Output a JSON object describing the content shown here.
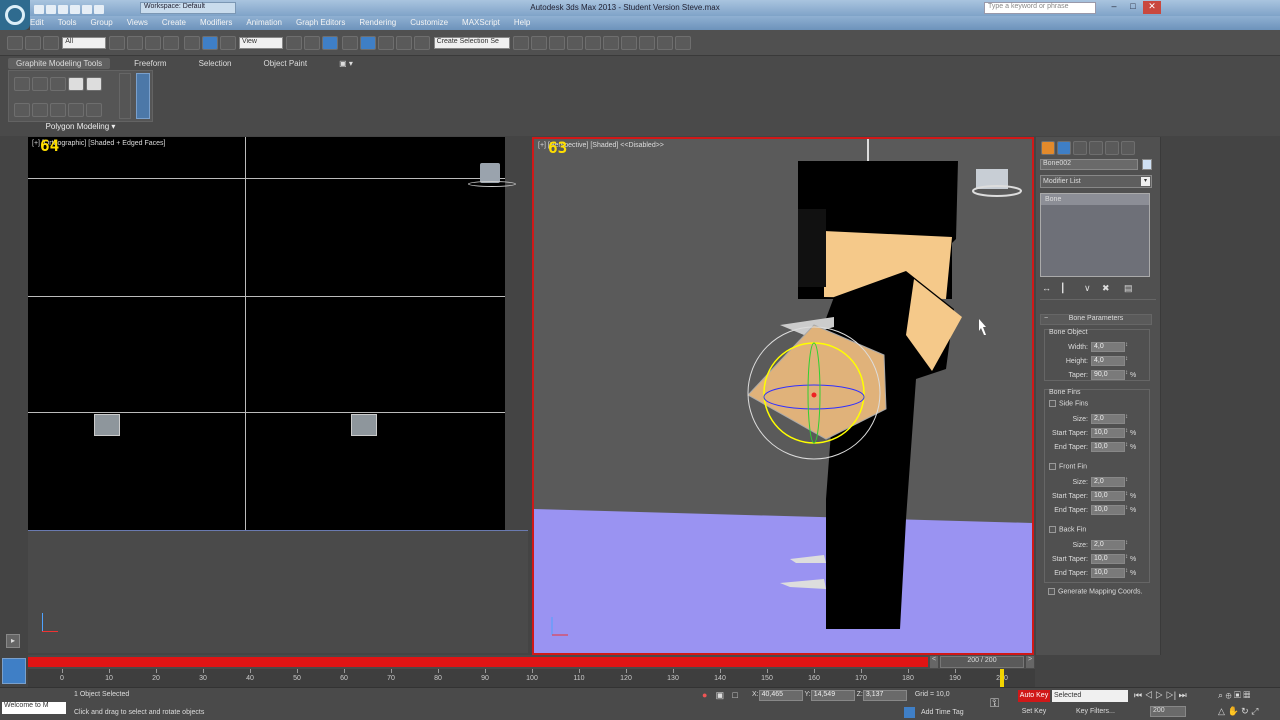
{
  "window": {
    "title": "Autodesk 3ds Max 2013 - Student Version   Steve.max",
    "workspace": "Workspace: Default",
    "search_placeholder": "Type a keyword or phrase"
  },
  "menu": [
    "Edit",
    "Tools",
    "Group",
    "Views",
    "Create",
    "Modifiers",
    "Animation",
    "Graph Editors",
    "Rendering",
    "Customize",
    "MAXScript",
    "Help"
  ],
  "toolbar": {
    "filter_value": "All",
    "refcoord_value": "View",
    "selection_set_placeholder": "Create Selection Se"
  },
  "ribbon": {
    "tabs": [
      "Graphite Modeling Tools",
      "Freeform",
      "Selection",
      "Object Paint"
    ],
    "panel_label": "Polygon Modeling"
  },
  "viewport_left": {
    "label": "[+] [Orthographic] [Shaded + Edged Faces]",
    "overlay_number": "64"
  },
  "viewport_right": {
    "label": "[+] [Perspective] [Shaded] <<Disabled>>",
    "overlay_number": "63"
  },
  "command_panel": {
    "object_name": "Bone002",
    "modifier_list": "Modifier List",
    "stack_items": [
      "Bone"
    ],
    "rollout_title": "Bone Parameters",
    "bone_object": {
      "header": "Bone Object",
      "rows": [
        {
          "label": "Width:",
          "value": "4,0",
          "unit": ""
        },
        {
          "label": "Height:",
          "value": "4,0",
          "unit": ""
        },
        {
          "label": "Taper:",
          "value": "90,0",
          "unit": "%"
        }
      ]
    },
    "bone_fins_header": "Bone Fins",
    "fins": [
      {
        "name": "Side Fins",
        "rows": [
          {
            "label": "Size:",
            "value": "2,0",
            "unit": ""
          },
          {
            "label": "Start Taper:",
            "value": "10,0",
            "unit": "%"
          },
          {
            "label": "End Taper:",
            "value": "10,0",
            "unit": "%"
          }
        ]
      },
      {
        "name": "Front Fin",
        "rows": [
          {
            "label": "Size:",
            "value": "2,0",
            "unit": ""
          },
          {
            "label": "Start Taper:",
            "value": "10,0",
            "unit": "%"
          },
          {
            "label": "End Taper:",
            "value": "10,0",
            "unit": "%"
          }
        ]
      },
      {
        "name": "Back Fin",
        "rows": [
          {
            "label": "Size:",
            "value": "2,0",
            "unit": ""
          },
          {
            "label": "Start Taper:",
            "value": "10,0",
            "unit": "%"
          },
          {
            "label": "End Taper:",
            "value": "10,0",
            "unit": "%"
          }
        ]
      }
    ],
    "generate_mapping": "Generate Mapping Coords."
  },
  "timeline": {
    "frame_display": "200 / 200",
    "current_frame": 200,
    "max_frame": 200,
    "ticks": [
      "0",
      "10",
      "20",
      "30",
      "40",
      "50",
      "60",
      "70",
      "80",
      "90",
      "100",
      "110",
      "120",
      "130",
      "140",
      "150",
      "160",
      "170",
      "180",
      "190",
      "200"
    ]
  },
  "status": {
    "selected": "1 Object Selected",
    "prompt": "Click and drag to select and rotate objects",
    "x_label": "X:",
    "x_value": "40,465",
    "y_label": "Y:",
    "y_value": "14,549",
    "z_label": "Z:",
    "z_value": "3,137",
    "grid": "Grid = 10,0",
    "add_time_tag": "Add Time Tag",
    "auto_key": "Auto Key",
    "set_key": "Set Key",
    "key_mode": "Selected",
    "key_filters": "Key Filters...",
    "frame_field": "200",
    "maxscript": "Welcome to M"
  },
  "colors": {
    "accent_red": "#d01818",
    "overlay_yellow": "#ffde00",
    "ground_blue": "#9a93f2",
    "skin": "#f5c98a"
  }
}
